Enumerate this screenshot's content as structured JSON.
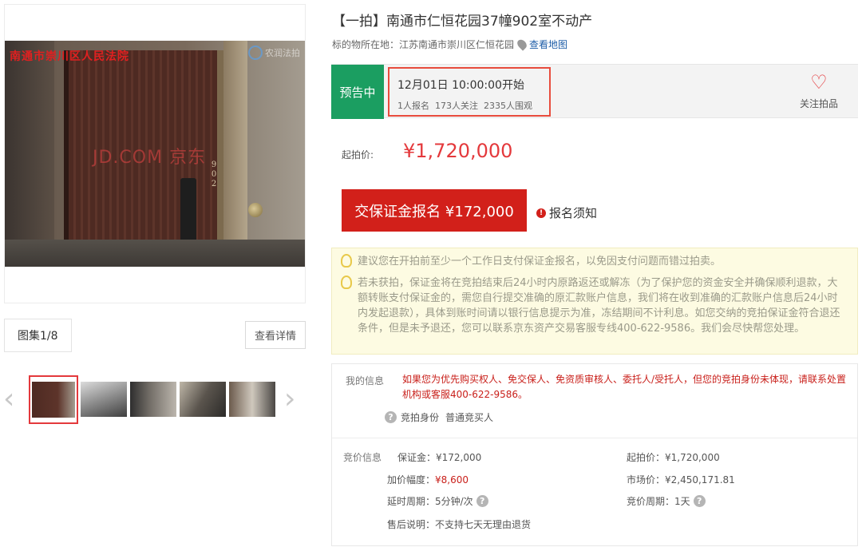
{
  "gallery": {
    "watermark_top": "南通市崇川区人民法院",
    "watermark_center": "JD.COM 京东",
    "logo_text": "农润法拍",
    "door_number": "9\n0\n2",
    "count_label": "图集1/8",
    "view_details": "查看详情",
    "prev_arrow": "‹",
    "next_arrow": "›"
  },
  "item": {
    "title": "【一拍】南通市仁恒花园37幢902室不动产",
    "location_label": "标的物所在地：江苏南通市崇川区仁恒花园",
    "map_link": "查看地图"
  },
  "status": {
    "badge": "预告中",
    "start_time": "12月01日 10:00:00开始",
    "stats": "1人报名  173人关注  2335人围观",
    "follow_label": "关注拍品",
    "follow_icon": "♡"
  },
  "price": {
    "label": "起拍价:",
    "value": "¥1,720,000"
  },
  "actions": {
    "deposit_button": "交保证金报名 ¥172,000",
    "notice_link": "报名须知",
    "alert_glyph": "!"
  },
  "tips": [
    "建议您在开拍前至少一个工作日支付保证金报名，以免因支付问题而错过拍卖。",
    "若未获拍，保证金将在竞拍结束后24小时内原路返还或解冻（为了保护您的资金安全并确保顺利退款，大额转账支付保证金的，需您自行提交准确的原汇款账户信息，我们将在收到准确的汇款账户信息后24小时内发起退款），具体到账时间请以银行信息提示为准，冻结期间不计利息。如您交纳的竞拍保证金符合退还条件，但是未予退还，您可以联系京东资产交易客服专线400-622-9586。我们会尽快帮您处理。"
  ],
  "my_info": {
    "label": "我的信息",
    "warning": "如果您为优先购买权人、免交保人、免资质审核人、委托人/受托人，但您的竞拍身份未体现，请联系处置机构或客服400-622-9586。",
    "identity_label": "竞拍身份",
    "identity_value": "普通竞买人",
    "help_glyph": "?"
  },
  "bid_info": {
    "label": "竞价信息",
    "deposit": "保证金：¥172,000",
    "start_price": "起拍价：¥1,720,000",
    "increment_label": "加价幅度：",
    "increment_value": "¥8,600",
    "market_price": "市场价：¥2,450,171.81",
    "delay": "延时周期：5分钟/次",
    "bid_cycle": "竞价周期：1天",
    "after_sale": "售后说明：不支持七天无理由退货"
  },
  "colors": {
    "accent_red": "#e4393c",
    "status_green": "#1b9e61",
    "button_red": "#d2201a"
  }
}
